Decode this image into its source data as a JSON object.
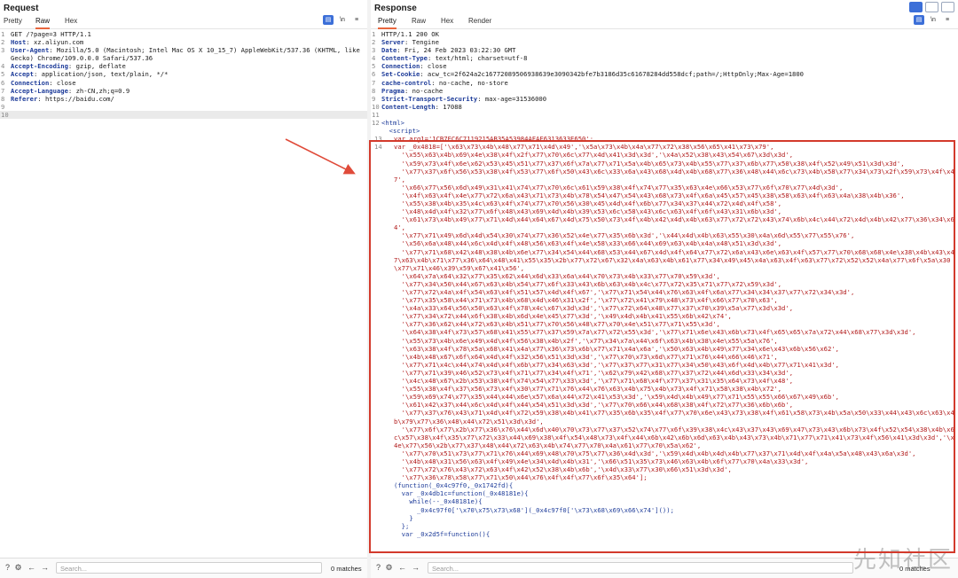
{
  "request": {
    "title": "Request",
    "tabs": [
      "Pretty",
      "Raw",
      "Hex"
    ],
    "active_tab": "Raw",
    "lines": [
      {
        "n": "1",
        "k": "",
        "v": "GET /?page=3 HTTP/1.1"
      },
      {
        "n": "2",
        "k": "Host",
        "v": ": xz.aliyun.com"
      },
      {
        "n": "3",
        "k": "User-Agent",
        "v": ": Mozilla/5.0 (Macintosh; Intel Mac OS X 10_15_7) AppleWebKit/537.36 (KHTML, like Gecko) Chrome/109.0.0.0 Safari/537.36"
      },
      {
        "n": "4",
        "k": "Accept-Encoding",
        "v": ": gzip, deflate"
      },
      {
        "n": "5",
        "k": "Accept",
        "v": ": application/json, text/plain, */*"
      },
      {
        "n": "6",
        "k": "Connection",
        "v": ": close"
      },
      {
        "n": "7",
        "k": "Accept-Language",
        "v": ": zh-CN,zh;q=0.9"
      },
      {
        "n": "8",
        "k": "Referer",
        "v": ": https://baidu.com/"
      },
      {
        "n": "9",
        "k": "",
        "v": ""
      },
      {
        "n": "10",
        "k": "",
        "v": ""
      }
    ],
    "search_placeholder": "Search...",
    "matches": "0 matches"
  },
  "response": {
    "title": "Response",
    "tabs": [
      "Pretty",
      "Raw",
      "Hex",
      "Render"
    ],
    "active_tab": "Pretty",
    "headers": [
      {
        "n": "1",
        "k": "",
        "v": "HTTP/1.1 200 OK"
      },
      {
        "n": "2",
        "k": "Server",
        "v": ": Tengine"
      },
      {
        "n": "3",
        "k": "Date",
        "v": ": Fri, 24 Feb 2023 03:22:30 GMT"
      },
      {
        "n": "4",
        "k": "Content-Type",
        "v": ": text/html; charset=utf-8"
      },
      {
        "n": "5",
        "k": "Connection",
        "v": ": close"
      },
      {
        "n": "6",
        "k": "Set-Cookie",
        "v": ": acw_tc=2f624a2c16772089506938639e3090342bfe7b3186d35c61678284dd558dcf;path=/;HttpOnly;Max-Age=1800"
      },
      {
        "n": "7",
        "k": "cache-control",
        "v": ": no-cache, no-store"
      },
      {
        "n": "8",
        "k": "Pragma",
        "v": ": no-cache"
      },
      {
        "n": "9",
        "k": "Strict-Transport-Security",
        "v": ": max-age=31536000"
      },
      {
        "n": "10",
        "k": "Content-Length",
        "v": ": 17088"
      },
      {
        "n": "11",
        "k": "",
        "v": ""
      }
    ],
    "html_tag": "<html>",
    "script_tag": "<script>",
    "arg_line": {
      "n": "13",
      "text": "var arg1='1CB7EC6C7119215AB35A53984AFAF6313633E650';"
    },
    "arr_head": {
      "n": "14",
      "text": "var _0x4818=['\\x63\\x73\\x4b\\x48\\x77\\x71\\x4d\\x49','\\x5a\\x73\\x4b\\x4a\\x77\\x72\\x38\\x56\\x65\\x41\\x73\\x79',"
    },
    "arr_lines": [
      "'\\x55\\x63\\x4b\\x69\\x4e\\x38\\x4f\\x2f\\x77\\x70\\x6c\\x77\\x4d\\x41\\x3d\\x3d','\\x4a\\x52\\x38\\x43\\x54\\x67\\x3d\\x3d',",
      "'\\x59\\x73\\x4f\\x6e\\x62\\x53\\x45\\x51\\x77\\x37\\x6f\\x7a\\x77\\x71\\x5a\\x4b\\x65\\x73\\x4b\\x55\\x77\\x37\\x6b\\x77\\x50\\x38\\x4f\\x52\\x49\\x51\\x3d\\x3d',",
      "'\\x77\\x37\\x6f\\x56\\x53\\x38\\x4f\\x53\\x77\\x6f\\x50\\x43\\x6c\\x33\\x6a\\x43\\x68\\x4d\\x4b\\x68\\x77\\x36\\x48\\x44\\x6c\\x73\\x4b\\x58\\x77\\x34\\x73\\x2f\\x59\\x73\\x4f\\x47',",
      "'\\x66\\x77\\x56\\x6d\\x49\\x31\\x41\\x74\\x77\\x70\\x6c\\x61\\x59\\x38\\x4f\\x74\\x77\\x35\\x63\\x4e\\x66\\x53\\x77\\x6f\\x70\\x77\\x4d\\x3d',",
      "'\\x4f\\x63\\x4f\\x4e\\x77\\x72\\x6a\\x43\\x71\\x73\\x4b\\x78\\x54\\x47\\x54\\x43\\x68\\x73\\x4f\\x6a\\x45\\x57\\x45\\x38\\x58\\x63\\x4f\\x63\\x4a\\x38\\x4b\\x36',",
      "'\\x55\\x38\\x4b\\x35\\x4c\\x63\\x4f\\x74\\x77\\x70\\x56\\x30\\x45\\x4d\\x4f\\x6b\\x77\\x34\\x37\\x44\\x72\\x4d\\x4f\\x58',",
      "'\\x48\\x4d\\x4f\\x32\\x77\\x6f\\x48\\x43\\x69\\x4d\\x4b\\x39\\x53\\x6c\\x58\\x43\\x6c\\x63\\x4f\\x6f\\x43\\x31\\x6b\\x3d',",
      "'\\x61\\x73\\x4b\\x49\\x77\\x71\\x4d\\x44\\x64\\x67\\x4d\\x75\\x50\\x73\\x4f\\x4b\\x42\\x4d\\x4b\\x63\\x77\\x72\\x72\\x43\\x74\\x6b\\x4c\\x44\\x72\\x4d\\x4b\\x42\\x77\\x36\\x34\\x64',",
      "'\\x77\\x71\\x49\\x6d\\x4d\\x54\\x30\\x74\\x77\\x36\\x52\\x4e\\x77\\x35\\x6b\\x3d','\\x44\\x4d\\x4b\\x63\\x55\\x30\\x4a\\x6d\\x55\\x77\\x55\\x76',",
      "'\\x56\\x6a\\x48\\x44\\x6c\\x4d\\x4f\\x48\\x56\\x63\\x4f\\x4e\\x58\\x33\\x66\\x44\\x69\\x63\\x4b\\x4a\\x48\\x51\\x3d\\x3d',",
      "'\\x77\\x71\\x68\\x42\\x48\\x38\\x4b\\x6e\\x77\\x34\\x54\\x44\\x68\\x53\\x44\\x67\\x4d\\x4f\\x64\\x77\\x72\\x6a\\x43\\x6e\\x63\\x4f\\x57\\x77\\x70\\x68\\x68\\x4e\\x38\\x4b\\x43\\x47\\x63\\x4b\\x71\\x77\\x36\\x64\\x48\\x41\\x55\\x35\\x2b\\x77\\x72\\x67\\x32\\x4a\\x63\\x4b\\x61\\x77\\x34\\x49\\x45\\x4a\\x63\\x4f\\x63\\x77\\x72\\x52\\x52\\x4a\\x77\\x6f\\x5a\\x30\\x77\\x71\\x46\\x39\\x59\\x67\\x41\\x56',",
      "'\\x64\\x7a\\x64\\x32\\x77\\x35\\x62\\x44\\x6d\\x33\\x6a\\x44\\x70\\x73\\x4b\\x33\\x77\\x70\\x59\\x3d',",
      "'\\x77\\x34\\x50\\x44\\x67\\x63\\x4b\\x54\\x77\\x6f\\x33\\x43\\x6b\\x63\\x4b\\x4c\\x77\\x72\\x35\\x71\\x77\\x72\\x59\\x3d',",
      "'\\x77\\x72\\x4a\\x4f\\x54\\x63\\x4f\\x51\\x57\\x4d\\x4f\\x67','\\x77\\x71\\x54\\x44\\x76\\x63\\x4f\\x6a\\x77\\x34\\x34\\x37\\x77\\x72\\x34\\x3d',",
      "'\\x77\\x35\\x58\\x44\\x71\\x73\\x4b\\x68\\x4d\\x46\\x31\\x2f','\\x77\\x72\\x41\\x79\\x48\\x73\\x4f\\x66\\x77\\x70\\x63',",
      "'\\x4a\\x33\\x64\\x56\\x50\\x63\\x4f\\x78\\x4c\\x67\\x3d\\x3d','\\x77\\x72\\x64\\x48\\x77\\x37\\x70\\x39\\x5a\\x77\\x3d\\x3d',",
      "'\\x77\\x34\\x72\\x44\\x6f\\x38\\x4b\\x6d\\x4e\\x45\\x77\\x3d','\\x49\\x4d\\x4b\\x41\\x55\\x6b\\x42\\x74',",
      "'\\x77\\x36\\x62\\x44\\x72\\x63\\x4b\\x51\\x77\\x70\\x56\\x48\\x77\\x70\\x4e\\x51\\x77\\x71\\x55\\x3d',",
      "'\\x64\\x38\\x4f\\x73\\x57\\x68\\x41\\x55\\x77\\x37\\x59\\x7a\\x77\\x72\\x55\\x3d','\\x77\\x71\\x6e\\x43\\x6b\\x73\\x4f\\x65\\x65\\x7a\\x72\\x44\\x68\\x77\\x3d\\x3d',",
      "'\\x55\\x73\\x4b\\x6e\\x49\\x4d\\x4f\\x56\\x38\\x4b\\x2f','\\x77\\x34\\x7a\\x44\\x6f\\x63\\x4b\\x38\\x4e\\x55\\x5a\\x76',",
      "'\\x63\\x38\\x4f\\x78\\x5a\\x68\\x41\\x4a\\x77\\x36\\x73\\x6b\\x77\\x71\\x4a\\x6a','\\x50\\x63\\x4b\\x49\\x77\\x34\\x6e\\x43\\x6b\\x56\\x62',",
      "'\\x4b\\x48\\x67\\x6f\\x64\\x4d\\x4f\\x32\\x56\\x51\\x3d\\x3d','\\x77\\x70\\x73\\x6d\\x77\\x71\\x76\\x44\\x66\\x46\\x71',",
      "'\\x77\\x71\\x4c\\x44\\x74\\x4d\\x4f\\x6b\\x77\\x34\\x63\\x3d','\\x77\\x37\\x77\\x31\\x77\\x34\\x50\\x43\\x6f\\x4d\\x4b\\x77\\x71\\x41\\x3d',",
      "'\\x77\\x71\\x39\\x46\\x52\\x73\\x4f\\x71\\x77\\x34\\x4f\\x71','\\x62\\x79\\x42\\x68\\x77\\x37\\x72\\x44\\x6d\\x33\\x34\\x3d',",
      "'\\x4c\\x48\\x67\\x2b\\x53\\x38\\x4f\\x74\\x54\\x77\\x33\\x3d','\\x77\\x71\\x68\\x4f\\x77\\x37\\x31\\x35\\x64\\x73\\x4f\\x48',",
      "'\\x55\\x38\\x4f\\x37\\x56\\x73\\x4f\\x30\\x77\\x71\\x76\\x44\\x76\\x63\\x4b\\x75\\x4b\\x73\\x4f\\x71\\x58\\x38\\x4b\\x72',",
      "'\\x59\\x69\\x74\\x77\\x35\\x44\\x44\\x6e\\x57\\x6a\\x44\\x72\\x41\\x53\\x3d','\\x59\\x4d\\x4b\\x49\\x77\\x71\\x55\\x55\\x66\\x67\\x49\\x6b',",
      "'\\x61\\x42\\x37\\x44\\x6c\\x4d\\x4f\\x44\\x54\\x51\\x3d\\x3d','\\x77\\x70\\x66\\x44\\x68\\x38\\x4f\\x72\\x77\\x36\\x6b\\x6b',",
      "'\\x77\\x37\\x76\\x43\\x71\\x4d\\x4f\\x72\\x59\\x38\\x4b\\x41\\x77\\x35\\x6b\\x35\\x4f\\x77\\x70\\x6e\\x43\\x73\\x38\\x4f\\x61\\x58\\x73\\x4b\\x5a\\x50\\x33\\x44\\x43\\x6c\\x63\\x4b\\x79\\x77\\x36\\x48\\x44\\x72\\x51\\x3d\\x3d',",
      "'\\x77\\x6f\\x77\\x2b\\x77\\x36\\x76\\x44\\x6d\\x40\\x70\\x73\\x77\\x37\\x52\\x74\\x77\\x6f\\x39\\x38\\x4c\\x43\\x37\\x43\\x69\\x47\\x73\\x43\\x6b\\x73\\x4f\\x52\\x54\\x38\\x4b\\x6c\\x57\\x38\\x4f\\x35\\x77\\x72\\x33\\x44\\x69\\x38\\x4f\\x54\\x48\\x73\\x4f\\x44\\x6b\\x42\\x6b\\x6d\\x63\\x4b\\x43\\x73\\x4b\\x71\\x77\\x71\\x41\\x73\\x4f\\x56\\x41\\x3d\\x3d','\\x4e\\x77\\x56\\x2b\\x77\\x37\\x48\\x44\\x72\\x63\\x4b\\x74\\x77\\x70\\x4a\\x61\\x77\\x70\\x5a\\x62',",
      "'\\x77\\x70\\x51\\x73\\x77\\x71\\x76\\x44\\x69\\x48\\x70\\x75\\x77\\x36\\x4d\\x3d','\\x59\\x4d\\x4b\\x4d\\x4b\\x77\\x37\\x71\\x4d\\x4f\\x4a\\x5a\\x48\\x43\\x6a\\x3d',",
      "'\\x4b\\x48\\x31\\x56\\x63\\x4f\\x49\\x4e\\x34\\x4d\\x4b\\x31','\\x66\\x51\\x35\\x73\\x46\\x63\\x4b\\x6f\\x77\\x70\\x4a\\x33\\x3d',",
      "'\\x77\\x72\\x76\\x43\\x72\\x63\\x4f\\x42\\x52\\x38\\x4b\\x6b','\\x4d\\x33\\x77\\x30\\x66\\x51\\x3d\\x3d',",
      "'\\x77\\x36\\x78\\x58\\x77\\x71\\x50\\x44\\x76\\x4f\\x4f\\x77\\x6f\\x35\\x64'];"
    ],
    "fn_lines": [
      "(function(_0x4c97f0,_0x1742fd){",
      "  var _0x4db1c=function(_0x48181e){",
      "    while(--_0x48181e){",
      "      _0x4c97f0['\\x70\\x75\\x73\\x68'](_0x4c97f0['\\x73\\x68\\x69\\x66\\x74']());",
      "    }",
      "  };",
      "  var _0x2d5f=function(){"
    ],
    "search_placeholder": "Search...",
    "matches": "0 matches"
  },
  "toolbar": {
    "wrap_label": "\\n",
    "menu_label": "≡"
  },
  "watermark": "先知社区"
}
